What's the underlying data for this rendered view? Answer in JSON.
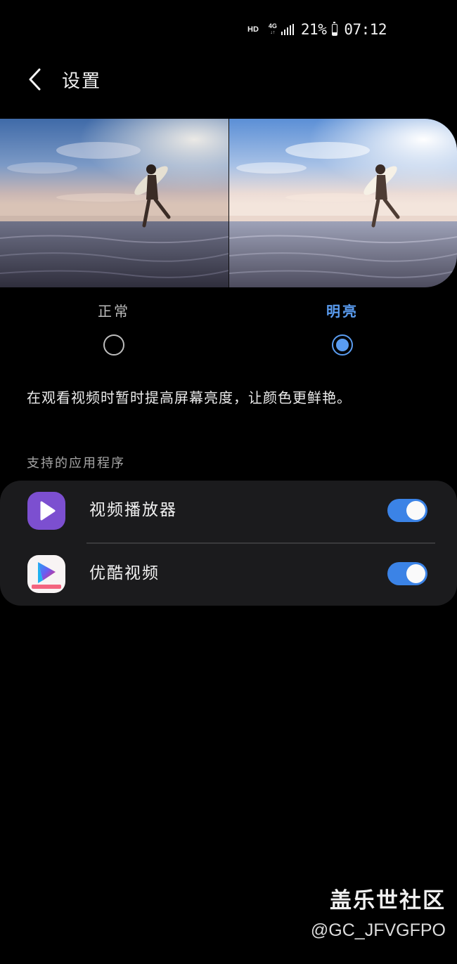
{
  "status_bar": {
    "hd": "HD",
    "network": "4G",
    "network_arrows": "↓↑",
    "battery": "21%",
    "battery_level": 0.21,
    "time": "07:12"
  },
  "header": {
    "back_icon": "chevron-left-icon",
    "title": "设置"
  },
  "preview": {
    "left_label": "正常",
    "right_label": "明亮",
    "selected": "明亮"
  },
  "description": "在观看视频时暂时提高屏幕亮度，让颜色更鲜艳。",
  "supported_apps": {
    "title": "支持的应用程序",
    "items": [
      {
        "label": "视频播放器",
        "icon": "play-icon",
        "enabled": true
      },
      {
        "label": "优酷视频",
        "icon": "youku-icon",
        "enabled": true
      }
    ]
  },
  "watermark": {
    "title": "盖乐世社区",
    "handle": "@GC_JFVGFPO"
  },
  "colors": {
    "accent": "#5a9cf0",
    "toggle_on": "#3b83e6",
    "card_bg": "#1b1b1d",
    "player_icon_bg": "#7c4fd0"
  }
}
